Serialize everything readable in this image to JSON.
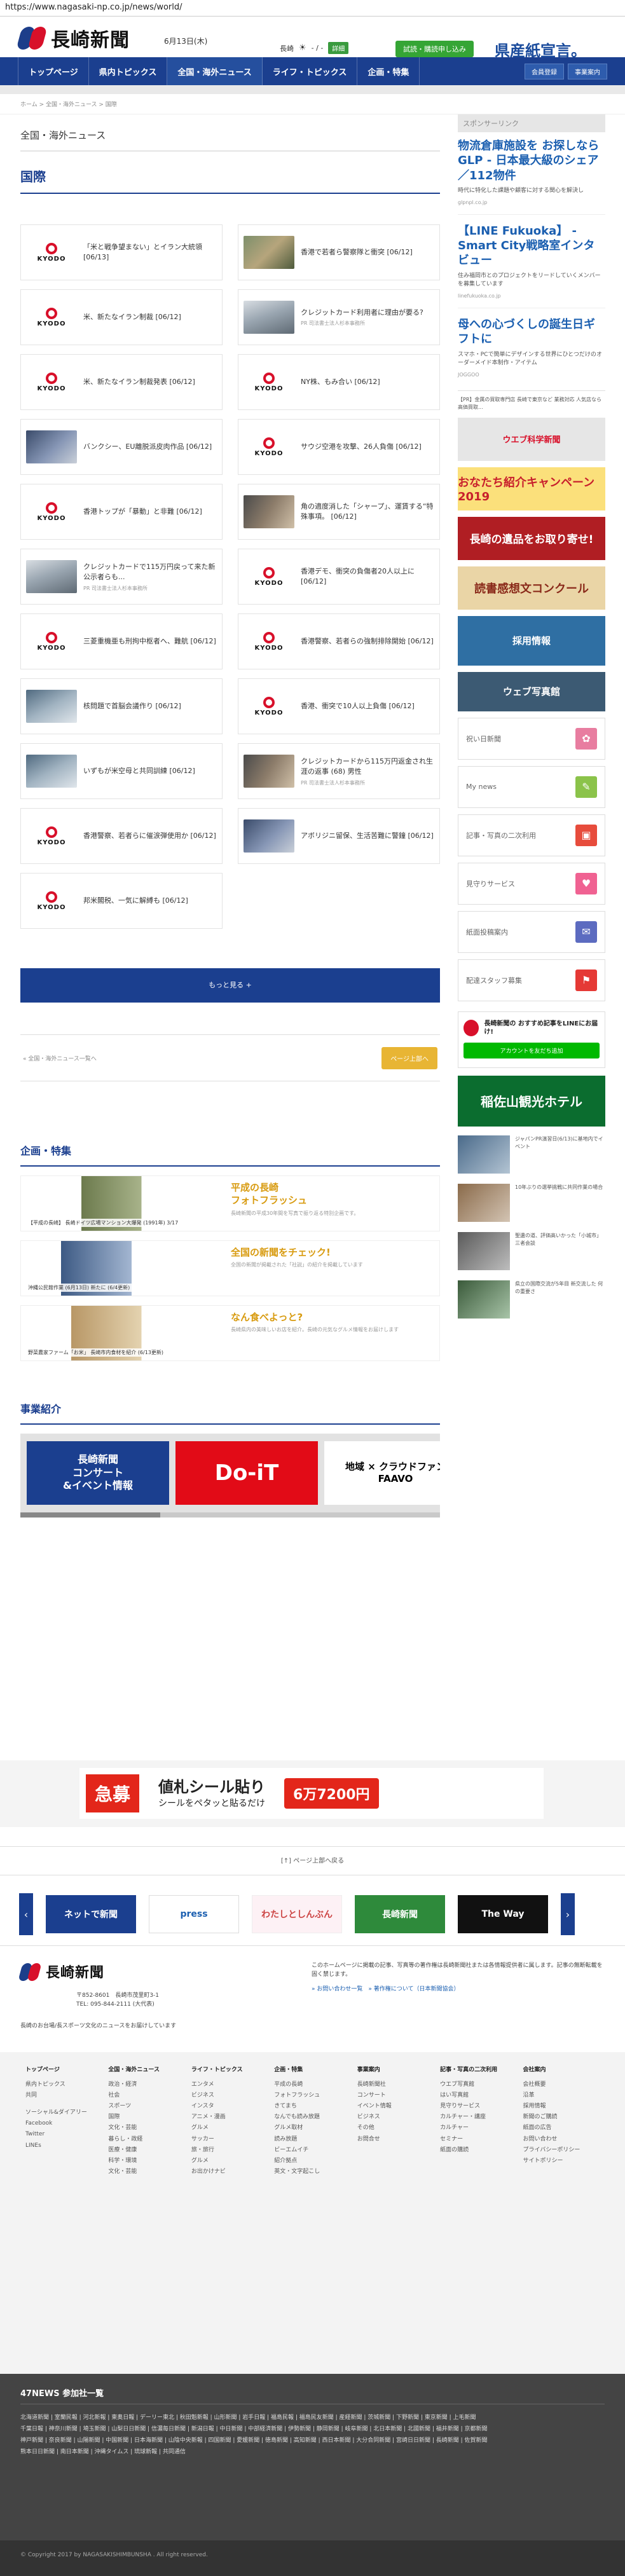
{
  "url": "https://www.nagasaki-np.co.jp/news/world/",
  "header": {
    "logo": "長崎新聞",
    "date": "6月13日(木)",
    "weather_city": "長崎",
    "weather_temp": "- / -",
    "weather_btn": "詳細",
    "trial": "試読・購読申し込み",
    "banner": "県産紙宣言。"
  },
  "nav": {
    "items": [
      "トップページ",
      "県内トピックス",
      "全国・海外ニュース",
      "ライフ・トピックス",
      "企画・特集"
    ],
    "right": [
      "会員登録",
      "事業案内"
    ]
  },
  "crumb": "ホーム > 全国・海外ニュース > 国際",
  "section_head": "全国・海外ニュース",
  "section_title": "国際",
  "articles": [
    {
      "text": "「米と戦争望まない」とイラン大統領 [06/13]",
      "note": "",
      "thumb": "kyodo"
    },
    {
      "text": "香港で若者ら警察隊と衝突 [06/12]",
      "note": "",
      "thumb": "photo1"
    },
    {
      "text": "米、新たなイラン制裁 [06/12]",
      "note": "",
      "thumb": "kyodo"
    },
    {
      "text": "クレジットカード利用者に理由が要る?",
      "note": "PR 司法書士法人杉本事務所",
      "thumb": "photo2"
    },
    {
      "text": "米、新たなイラン制裁発表 [06/12]",
      "note": "",
      "thumb": "kyodo"
    },
    {
      "text": "NY株、もみ合い [06/12]",
      "note": "",
      "thumb": "kyodo"
    },
    {
      "text": "バンクシー、EU離脱派皮肉作品 [06/12]",
      "note": "",
      "thumb": "photo3"
    },
    {
      "text": "サウジ空港を攻撃、26人負傷 [06/12]",
      "note": "",
      "thumb": "kyodo"
    },
    {
      "text": "香港トップが「暴動」と非難 [06/12]",
      "note": "",
      "thumb": "kyodo"
    },
    {
      "text": "角の適度消した「シャープ」、運賃する“特殊事項。 [06/12]",
      "note": "",
      "thumb": "photo4"
    },
    {
      "text": "クレジットカードで115万円戻って来た新公示者らも...",
      "note": "PR 司法書士法人杉本事務所",
      "thumb": "photo2"
    },
    {
      "text": "香港デモ、衝突の負傷者20人以上に [06/12]",
      "note": "",
      "thumb": "kyodo"
    },
    {
      "text": "三菱重機亜も刑拘中枢者へ、難航 [06/12]",
      "note": "",
      "thumb": "kyodo"
    },
    {
      "text": "香港警察、若者らの強制排除開始 [06/12]",
      "note": "",
      "thumb": "kyodo"
    },
    {
      "text": "核問題で首脳会議作り [06/12]",
      "note": "",
      "thumb": "photo5"
    },
    {
      "text": "香港、衝突で10人以上負傷 [06/12]",
      "note": "",
      "thumb": "kyodo"
    },
    {
      "text": "いずもが米空母と共同訓練 [06/12]",
      "note": "",
      "thumb": "photo5"
    },
    {
      "text": "クレジットカードから115万円返金され生涯の返事 (68) 男性",
      "note": "PR 司法書士法人杉本事務所",
      "thumb": "photo4"
    },
    {
      "text": "香港警察、若者らに催涙弾使用か [06/12]",
      "note": "",
      "thumb": "kyodo"
    },
    {
      "text": "アボリジニ留保、生活苦難に警鐘 [06/12]",
      "note": "",
      "thumb": "photo3"
    },
    {
      "text": "邦米閣税、一気に解縛も [06/12]",
      "note": "",
      "thumb": "kyodo"
    }
  ],
  "kyodo_label": "KYODO",
  "more_btn": "もっと見る +",
  "pager": {
    "back": "« 全国・海外ニュース一覧へ",
    "up": "ページ上部へ"
  },
  "plans_title": "企画・特集",
  "plans": [
    {
      "cap": "【平成の長崎】 長崎ドイツ広場マンション大爆発 (1991年) 3/17",
      "title": "平成の長崎\nフォトフラッシュ",
      "desc": "長崎新聞の平成30年間を写真で振り返る特別企画です。"
    },
    {
      "cap": "沖縄公民館作業 (6月13日) 新たに (6/4更新)",
      "title": "全国の新聞をチェック!",
      "desc": "全国の新聞が掲載された「社説」の紹介を掲載しています"
    },
    {
      "cap": "野菜農家ファーム「お米」 長崎市内食材を紹介 (6/13更新)",
      "title": "なん食べよっと?",
      "desc": "長崎県内の美味しいお店を紹介。長崎の元気なグルメ情報をお届けします"
    }
  ],
  "biz_title": "事業紹介",
  "biz": [
    "長崎新聞\nコンサート\n&イベント情報",
    "Do-iT",
    "地域 × クラウドファン\nFAAVO"
  ],
  "sidebar": {
    "head": "スポンサーリンク",
    "ads": [
      {
        "title": "物流倉庫施設を お探しならGLP - 日本最大級のシェア／112物件",
        "desc": "時代に特化した課題や顧客に対する関心を解決し",
        "src": "glpnpl.co.jp"
      },
      {
        "title": "【LINE Fukuoka】 - Smart City戦略室インタビュー",
        "desc": "住み福岡市とのプロジェクトをリードしていくメンバーを募集しています",
        "src": "linefukuoka.co.jp"
      },
      {
        "title": "母への心づくしの誕生日ギフトに",
        "desc": "スマホ・PCで簡単にデザインする世界にひとつだけのオーダーメイド本制作・アイテム",
        "src": "JOGGOO"
      }
    ],
    "notice": "【PR】金属の買取専門店 長崎で東京など 業務対応 人気店なら 高価買取...",
    "banners": [
      "ウエブ科学新聞",
      "おなたち紹介キャンペーン 2019",
      "長崎の遺品をお取り寄せ!",
      "読書感想文コンクール",
      "採用情報",
      "ウェブ写真館"
    ],
    "links": [
      "祝い日新聞",
      "My news",
      "記事・写真の二次利用",
      "見守りサービス",
      "紙面投稿案内",
      "配達スタッフ募集"
    ],
    "line_title": "長崎新聞の おすすめ記事をLINEにお届け!",
    "line_btn": "アカウントを友だち追加",
    "hotel": "稲佐山観光ホテル",
    "mini_news": [
      "ジャパンPR演習日(6/13)に基地内でイベント",
      "10年ぶりの選挙挑戦に共同作業の場合",
      "聖遺の道、評価高いかった「小城市」三者会談",
      "県立の国際交流が5年目 新交流した 何の重要さ"
    ]
  },
  "wide_ad": {
    "kyu": "急募",
    "title": "値札シール貼り",
    "sub": "シールをペタッと貼るだけ",
    "price": "6万7200円"
  },
  "backtop": "[↑] ページ上部へ戻る",
  "carousel": [
    "ネットで新聞",
    "press",
    "わたしとしんぶん",
    "長崎新聞",
    "The Way"
  ],
  "footer": {
    "addr": "〒852-8601　長崎市茂里町3-1\nTEL: 095-844-2111 (大代表)",
    "desc": "長崎のお台場/長スポーツ文化のニュースをお届けしています",
    "right": "このホームページに掲載の記事、写真等の著作権は長崎新聞社または各情報提供者に属します。記事の無断転載を固く禁じます。",
    "links": "» お問い合わせ一覧　» 著作権について（日本新聞協会）",
    "cols": [
      {
        "head": "トップページ",
        "items": [
          "県内トピックス",
          "共同",
          "",
          "ソーシャル&ダイアリー",
          "Facebook",
          "Twitter",
          "LINEs"
        ]
      },
      {
        "head": "全国・海外ニュース",
        "items": [
          "政治・経済",
          "社会",
          "スポーツ",
          "国際",
          "文化・芸能",
          "暮らし・政経",
          "医療・健康",
          "科学・環境",
          "文化・芸能"
        ]
      },
      {
        "head": "ライフ・トピックス",
        "items": [
          "エンタメ",
          "ビジネス",
          "インスタ",
          "アニメ・漫画",
          "グルメ",
          "サッカー",
          "旅・旅行",
          "グルメ",
          "お出かけナビ"
        ]
      },
      {
        "head": "企画・特集",
        "items": [
          "平成の長崎",
          "フォトフラッシュ",
          "きてまち",
          "なんでも読み放題",
          "グルメ取材",
          "読み放題",
          "ビーエムイチ",
          "紹介拠点",
          "英文・文字起こし"
        ]
      },
      {
        "head": "事業案内",
        "items": [
          "長崎新聞社",
          "コンサート",
          "イベント情報",
          "ビジネス",
          "その他",
          "お問合せ"
        ]
      },
      {
        "head": "記事・写真の二次利用",
        "items": [
          "ウエブ写真館",
          "はい写真館",
          "見守りサービス",
          "カルチャー・講座",
          "カルチャー",
          "セミナー",
          "紙面の購読"
        ]
      },
      {
        "head": "会社案内",
        "items": [
          "会社概要",
          "沿革",
          "採用情報",
          "新聞のご購読",
          "紙面の広告",
          "お問い合わせ",
          "プライバシーポリシー",
          "サイトポリシー"
        ]
      }
    ]
  },
  "n47": {
    "head": "47NEWS 参加社一覧",
    "rows": [
      "北海道新聞 | 室蘭民報 | 河北新報 | 東奥日報 | デーリー東北 | 秋田魁新報 | 山形新聞 | 岩手日報 | 福島民報 | 福島民友新聞 | 産経新聞 | 茨城新聞 | 下野新聞 | 東京新聞 | 上毛新聞",
      "千葉日報 | 神奈川新聞 | 埼玉新聞 | 山梨日日新聞 | 信濃毎日新聞 | 新潟日報 | 中日新聞 | 中部経済新聞 | 伊勢新聞 | 静岡新聞 | 岐阜新聞 | 北日本新聞 | 北國新聞 | 福井新聞 | 京都新聞",
      "神戸新聞 | 奈良新聞 | 山陽新聞 | 中国新聞 | 日本海新聞 | 山陰中央新報 | 四国新聞 | 愛媛新聞 | 徳島新聞 | 高知新聞 | 西日本新聞 | 大分合同新聞 | 宮崎日日新聞 | 長崎新聞 | 佐賀新聞",
      "熊本日日新聞 | 南日本新聞 | 沖縄タイムス | 琉球新報 | 共同通信"
    ]
  },
  "copyright": "© Copyright 2017 by NAGASAKISHIMBUNSHA . All right reserved."
}
